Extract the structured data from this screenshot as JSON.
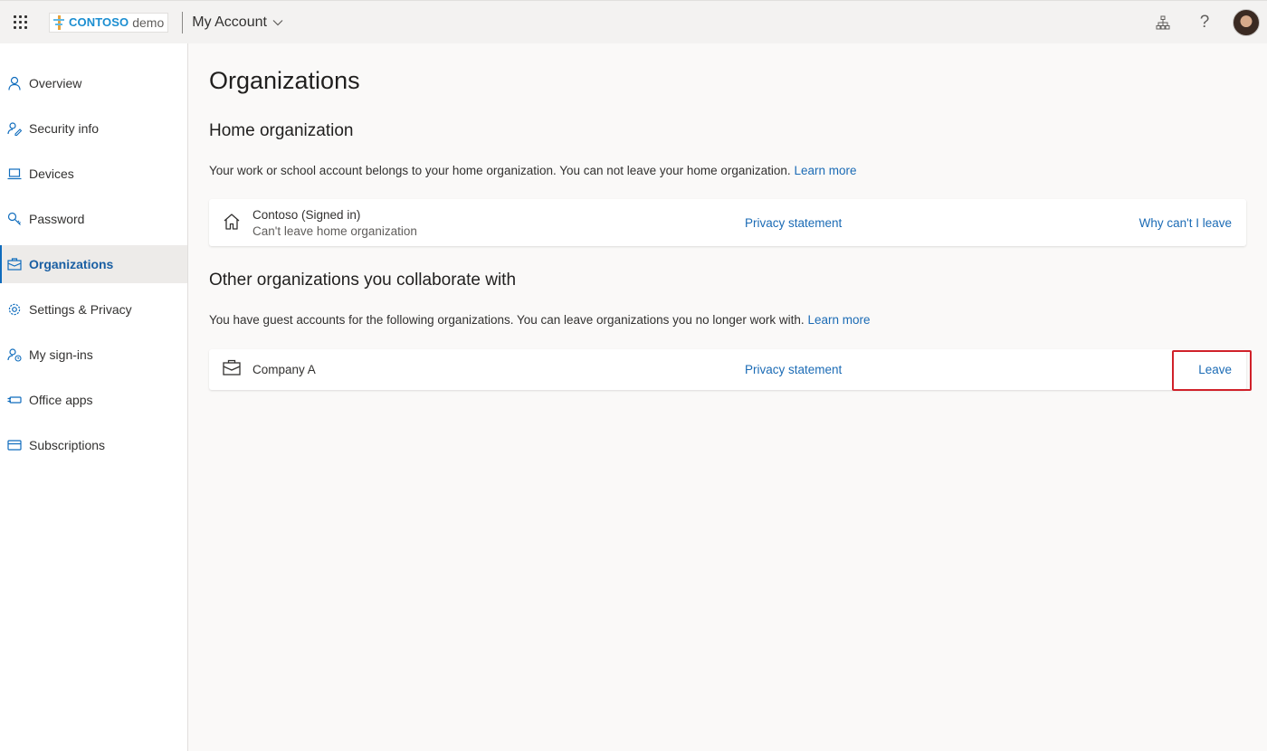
{
  "topbar": {
    "brand": "CONTOSO",
    "brand_suffix": "demo",
    "app_title": "My Account",
    "icons": [
      "waffle-icon",
      "org-chart-icon",
      "help-icon",
      "avatar"
    ],
    "help_glyph": "?"
  },
  "sidebar": {
    "items": [
      {
        "label": "Overview",
        "icon": "person-icon"
      },
      {
        "label": "Security info",
        "icon": "security-info-icon"
      },
      {
        "label": "Devices",
        "icon": "laptop-icon"
      },
      {
        "label": "Password",
        "icon": "key-icon"
      },
      {
        "label": "Organizations",
        "icon": "briefcase-icon",
        "active": true
      },
      {
        "label": "Settings & Privacy",
        "icon": "gear-icon"
      },
      {
        "label": "My sign-ins",
        "icon": "sign-ins-icon"
      },
      {
        "label": "Office apps",
        "icon": "office-apps-icon"
      },
      {
        "label": "Subscriptions",
        "icon": "card-icon"
      }
    ]
  },
  "main": {
    "title": "Organizations",
    "home": {
      "heading": "Home organization",
      "description": "Your work or school account belongs to your home organization. You can not leave your home organization.",
      "learn_more": "Learn more",
      "org_name": "Contoso (Signed in)",
      "org_sub": "Can't leave home organization",
      "privacy_link": "Privacy statement",
      "action_link": "Why can't I leave"
    },
    "other": {
      "heading": "Other organizations you collaborate with",
      "description": "You have guest accounts for the following organizations. You can leave organizations you no longer work with.",
      "learn_more": "Learn more",
      "org_name": "Company A",
      "privacy_link": "Privacy statement",
      "action_link": "Leave"
    }
  },
  "colors": {
    "accent": "#0f6cbd",
    "link": "#1b6bb5",
    "highlight": "#d0212a",
    "brand": "#1b8ed1"
  }
}
